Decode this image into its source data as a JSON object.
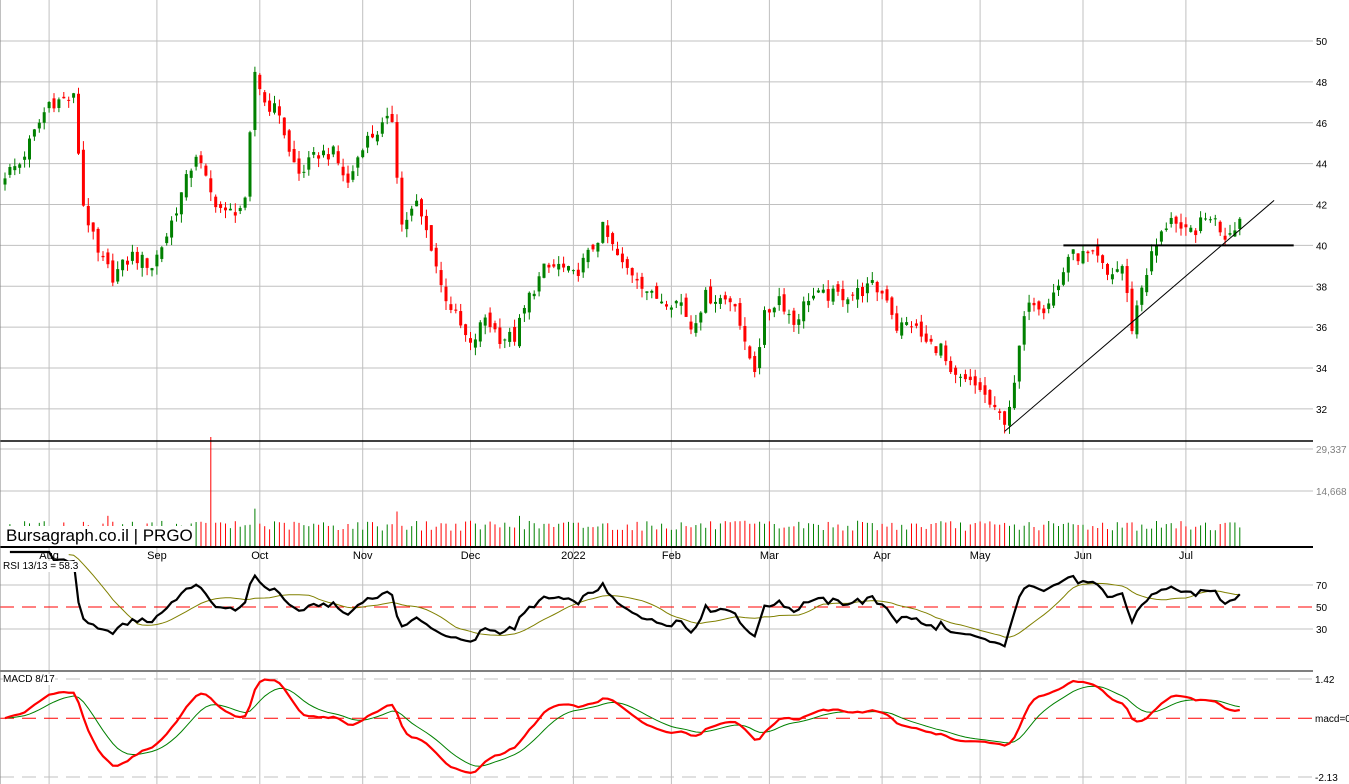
{
  "brand": "Bursagraph.co.il | PRGO",
  "chart_data": {
    "type": "candlestick",
    "symbol": "PRGO",
    "price_axis": {
      "ticks": [
        32,
        34,
        36,
        38,
        40,
        42,
        44,
        46,
        48,
        50
      ],
      "range": [
        30.4,
        52
      ]
    },
    "volume_axis": {
      "ticks": [
        "29,337",
        "14,668"
      ],
      "values": [
        29337,
        14668
      ]
    },
    "months": [
      {
        "label": "Aug",
        "day": 9
      },
      {
        "label": "Sep",
        "day": 31
      },
      {
        "label": "Oct",
        "day": 52
      },
      {
        "label": "Nov",
        "day": 73
      },
      {
        "label": "Dec",
        "day": 95
      },
      {
        "label": "2022",
        "day": 116
      },
      {
        "label": "Feb",
        "day": 136
      },
      {
        "label": "Mar",
        "day": 156
      },
      {
        "label": "Apr",
        "day": 179
      },
      {
        "label": "May",
        "day": 199
      },
      {
        "label": "Jun",
        "day": 220
      },
      {
        "label": "Jul",
        "day": 241
      }
    ],
    "price_path": [
      [
        0,
        43.5
      ],
      [
        3,
        44
      ],
      [
        6,
        45.5
      ],
      [
        9,
        47
      ],
      [
        14,
        47.2
      ],
      [
        16,
        42
      ],
      [
        19,
        39.5
      ],
      [
        22,
        38.5
      ],
      [
        26,
        39.5
      ],
      [
        30,
        39
      ],
      [
        33,
        40.5
      ],
      [
        36,
        42.5
      ],
      [
        39,
        44.5
      ],
      [
        42,
        42.5
      ],
      [
        45,
        41.5
      ],
      [
        49,
        42
      ],
      [
        51,
        48.5
      ],
      [
        53,
        47
      ],
      [
        56,
        46.5
      ],
      [
        58,
        44.5
      ],
      [
        60,
        43.5
      ],
      [
        64,
        44.5
      ],
      [
        67,
        44.5
      ],
      [
        70,
        43
      ],
      [
        73,
        45
      ],
      [
        79,
        46.2
      ],
      [
        81,
        41
      ],
      [
        84,
        42
      ],
      [
        87,
        40
      ],
      [
        89,
        38
      ],
      [
        92,
        36.5
      ],
      [
        95,
        35
      ],
      [
        98,
        36.5
      ],
      [
        101,
        35.5
      ],
      [
        104,
        35.5
      ],
      [
        107,
        37.5
      ],
      [
        110,
        38.8
      ],
      [
        113,
        39
      ],
      [
        116,
        38.5
      ],
      [
        119,
        39.5
      ],
      [
        122,
        40.8
      ],
      [
        126,
        39
      ],
      [
        129,
        38.5
      ],
      [
        132,
        37.5
      ],
      [
        138,
        37.2
      ],
      [
        140,
        36
      ],
      [
        143,
        37.5
      ],
      [
        149,
        37.3
      ],
      [
        151,
        35
      ],
      [
        153,
        34
      ],
      [
        155,
        36.5
      ],
      [
        158,
        37.5
      ],
      [
        161,
        36.2
      ],
      [
        164,
        37.5
      ],
      [
        173,
        37.6
      ],
      [
        177,
        38
      ],
      [
        180,
        37.5
      ],
      [
        182,
        36
      ],
      [
        185,
        36.2
      ],
      [
        188,
        35.2
      ],
      [
        191,
        35
      ],
      [
        193,
        33.5
      ],
      [
        196,
        33.3
      ],
      [
        199,
        33
      ],
      [
        202,
        31.8
      ],
      [
        204,
        31.5
      ],
      [
        206,
        33
      ],
      [
        207,
        35
      ],
      [
        209,
        37.5
      ],
      [
        212,
        37
      ],
      [
        215,
        38
      ],
      [
        217,
        39.5
      ],
      [
        220,
        39.5
      ],
      [
        223,
        39.3
      ],
      [
        225,
        38.5
      ],
      [
        228,
        39
      ],
      [
        230,
        36
      ],
      [
        232,
        38
      ],
      [
        234,
        39.5
      ],
      [
        236,
        40.5
      ],
      [
        238,
        41.5
      ],
      [
        240,
        40.5
      ],
      [
        243,
        40.8
      ],
      [
        246,
        41.5
      ],
      [
        249,
        40.5
      ],
      [
        252,
        41.3
      ]
    ],
    "volume_spikes": [
      [
        42,
        36000
      ],
      [
        51,
        8500
      ],
      [
        80,
        7500
      ],
      [
        105,
        6000
      ],
      [
        21,
        6000
      ]
    ],
    "trendlines": [
      {
        "name": "support",
        "from": [
          204,
          30.9
        ],
        "to": [
          259,
          42.2
        ]
      },
      {
        "name": "resistance",
        "from": [
          216,
          40
        ],
        "to": [
          263,
          40
        ]
      }
    ],
    "rsi": {
      "label": "RSI 13/13 = 58.3",
      "period": 13,
      "ma": 13,
      "ticks": [
        "70",
        "50",
        "30"
      ]
    },
    "macd": {
      "label": "MACD 8/17",
      "fast": 8,
      "slow": 17,
      "ticks": {
        "top": "1.42",
        "zero": "macd=0",
        "bottom": "-2.13"
      },
      "range": [
        -2.13,
        1.42
      ]
    },
    "colors": {
      "up": "#008000",
      "down": "#ff0000",
      "rsi": "#000000",
      "rsi_ma": "#808000",
      "macd": "#ff0000",
      "signal": "#008000",
      "grid": "#c0c0c0"
    }
  }
}
